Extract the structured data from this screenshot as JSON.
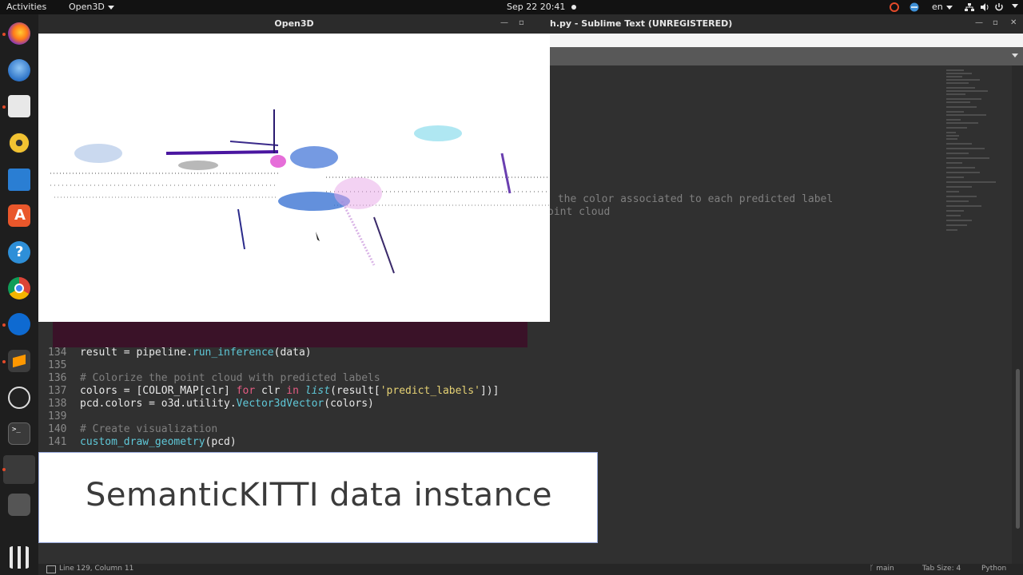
{
  "topbar": {
    "activities": "Activities",
    "app_menu": "Open3D",
    "clock": "Sep 22  20:41",
    "language": "en"
  },
  "open3d": {
    "title": "Open3D"
  },
  "sublime": {
    "title": "h.py - Sublime Text (UNREGISTERED)",
    "hidden_comment_1": " the color associated to each predicted label",
    "hidden_comment_2": "oint cloud",
    "code": {
      "l134_num": "134",
      "l134_a": "result = pipeline.",
      "l134_fn": "run_inference",
      "l134_b": "(data)",
      "l135_num": "135",
      "l136_num": "136",
      "l136_cmt": "# Colorize the point cloud with predicted labels",
      "l137_num": "137",
      "l137_a": "colors = [COLOR_MAP[clr] ",
      "l137_kw1": "for",
      "l137_b": " clr ",
      "l137_kw2": "in",
      "l137_c": " ",
      "l137_it": "list",
      "l137_d": "(result[",
      "l137_str": "'predict_labels'",
      "l137_e": "])]",
      "l138_num": "138",
      "l138_a": "pcd.colors = o3d.utility.",
      "l138_fn": "Vector3dVector",
      "l138_b": "(colors)",
      "l139_num": "139",
      "l140_num": "140",
      "l140_cmt": "# Create visualization",
      "l141_num": "141",
      "l141_fn": "custom_draw_geometry",
      "l141_b": "(pcd)"
    },
    "status": {
      "position": "Line 129, Column 11",
      "branch": "main",
      "tab_size": "Tab Size: 4",
      "syntax": "Python"
    }
  },
  "caption": {
    "text": "SemanticKITTI data instance"
  },
  "colors": {
    "accent_close": "#e0533a",
    "caption_bg": "#ffffff"
  },
  "icons": [
    "firefox-icon",
    "thunderbird-icon",
    "files-icon",
    "rhythmbox-icon",
    "writer-icon",
    "software-icon",
    "help-icon",
    "chrome-icon",
    "teamviewer-icon",
    "sublime-icon",
    "obs-icon",
    "terminal-icon",
    "app-icon",
    "usb-icon",
    "app-grid-icon"
  ]
}
